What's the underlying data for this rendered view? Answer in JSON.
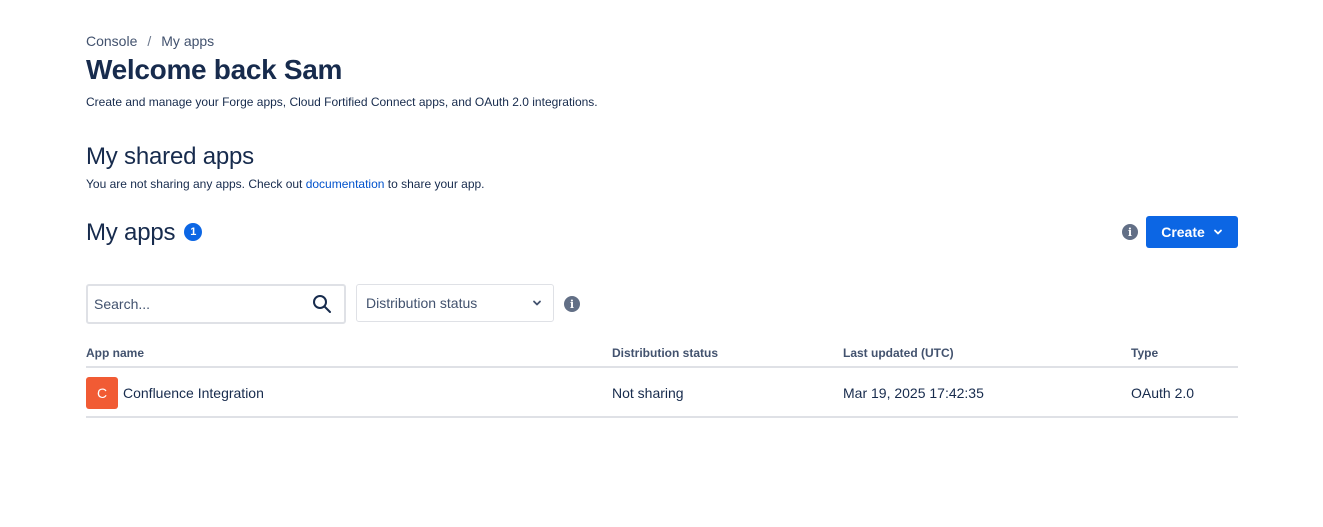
{
  "breadcrumb": {
    "items": [
      "Console",
      "My apps"
    ],
    "separator": "/"
  },
  "page": {
    "title": "Welcome back Sam",
    "description": "Create and manage your Forge apps, Cloud Fortified Connect apps, and OAuth 2.0 integrations."
  },
  "shared_apps": {
    "title": "My shared apps",
    "text_before": "You are not sharing any apps. Check out ",
    "link_label": "documentation",
    "text_after": " to share your app."
  },
  "my_apps": {
    "title": "My apps",
    "count": "1",
    "create_label": "Create"
  },
  "filters": {
    "search_placeholder": "Search...",
    "search_value": "",
    "distribution_status_label": "Distribution status"
  },
  "table": {
    "columns": [
      "App name",
      "Distribution status",
      "Last updated (UTC)",
      "Type"
    ],
    "rows": [
      {
        "avatar_letter": "C",
        "name": "Confluence Integration",
        "distribution_status": "Not sharing",
        "last_updated": "Mar 19, 2025 17:42:35",
        "type": "OAuth 2.0"
      }
    ]
  },
  "icons": {
    "info": "info-icon",
    "search": "search-icon",
    "chevron": "chevron-down-icon"
  },
  "colors": {
    "primary": "#0c66e4",
    "link": "#0052cc",
    "avatar": "#f15b34",
    "heading": "#172b4d"
  }
}
